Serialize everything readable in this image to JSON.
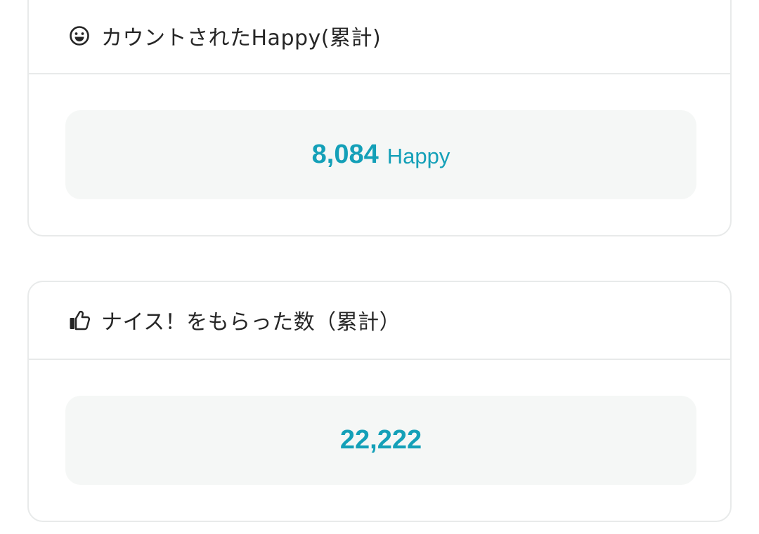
{
  "happy_card": {
    "icon": "smiley-face-icon",
    "title": "カウントされたHappy(累計)",
    "value": "8,084",
    "unit": "Happy"
  },
  "nice_card": {
    "icon": "thumbs-up-icon",
    "title": "ナイス！をもらった数（累計）",
    "value": "22,222"
  },
  "colors": {
    "accent": "#14a0b8",
    "card_border": "#e8eaea",
    "stat_background": "#f5f7f6",
    "text": "#262626"
  }
}
